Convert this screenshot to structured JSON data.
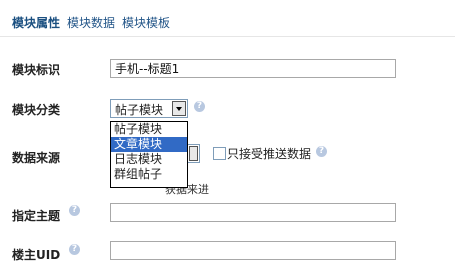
{
  "tabs": [
    {
      "label": "模块属性",
      "active": true
    },
    {
      "label": "模块数据",
      "active": false
    },
    {
      "label": "模块模板",
      "active": false
    }
  ],
  "fields": {
    "module_id": {
      "label": "模块标识",
      "value": "手机--标题1"
    },
    "module_category": {
      "label": "模块分类",
      "selected": "帖子模块"
    },
    "data_source": {
      "label": "数据来源"
    },
    "assigned_topic": {
      "label": "指定主题",
      "value": ""
    },
    "host_uid": {
      "label": "楼主UID",
      "value": ""
    }
  },
  "category_options": [
    "帖子模块",
    "文章模块",
    "日志模块",
    "群组帖子"
  ],
  "highlighted_option_index": 1,
  "push_checkbox": {
    "label": "只接受推送数据",
    "checked": false
  },
  "partial_text": "获据来进",
  "colors": {
    "tab_active": "#1a4f80",
    "tab": "#225588",
    "highlight": "#316ac5",
    "marker": "#e01010"
  }
}
